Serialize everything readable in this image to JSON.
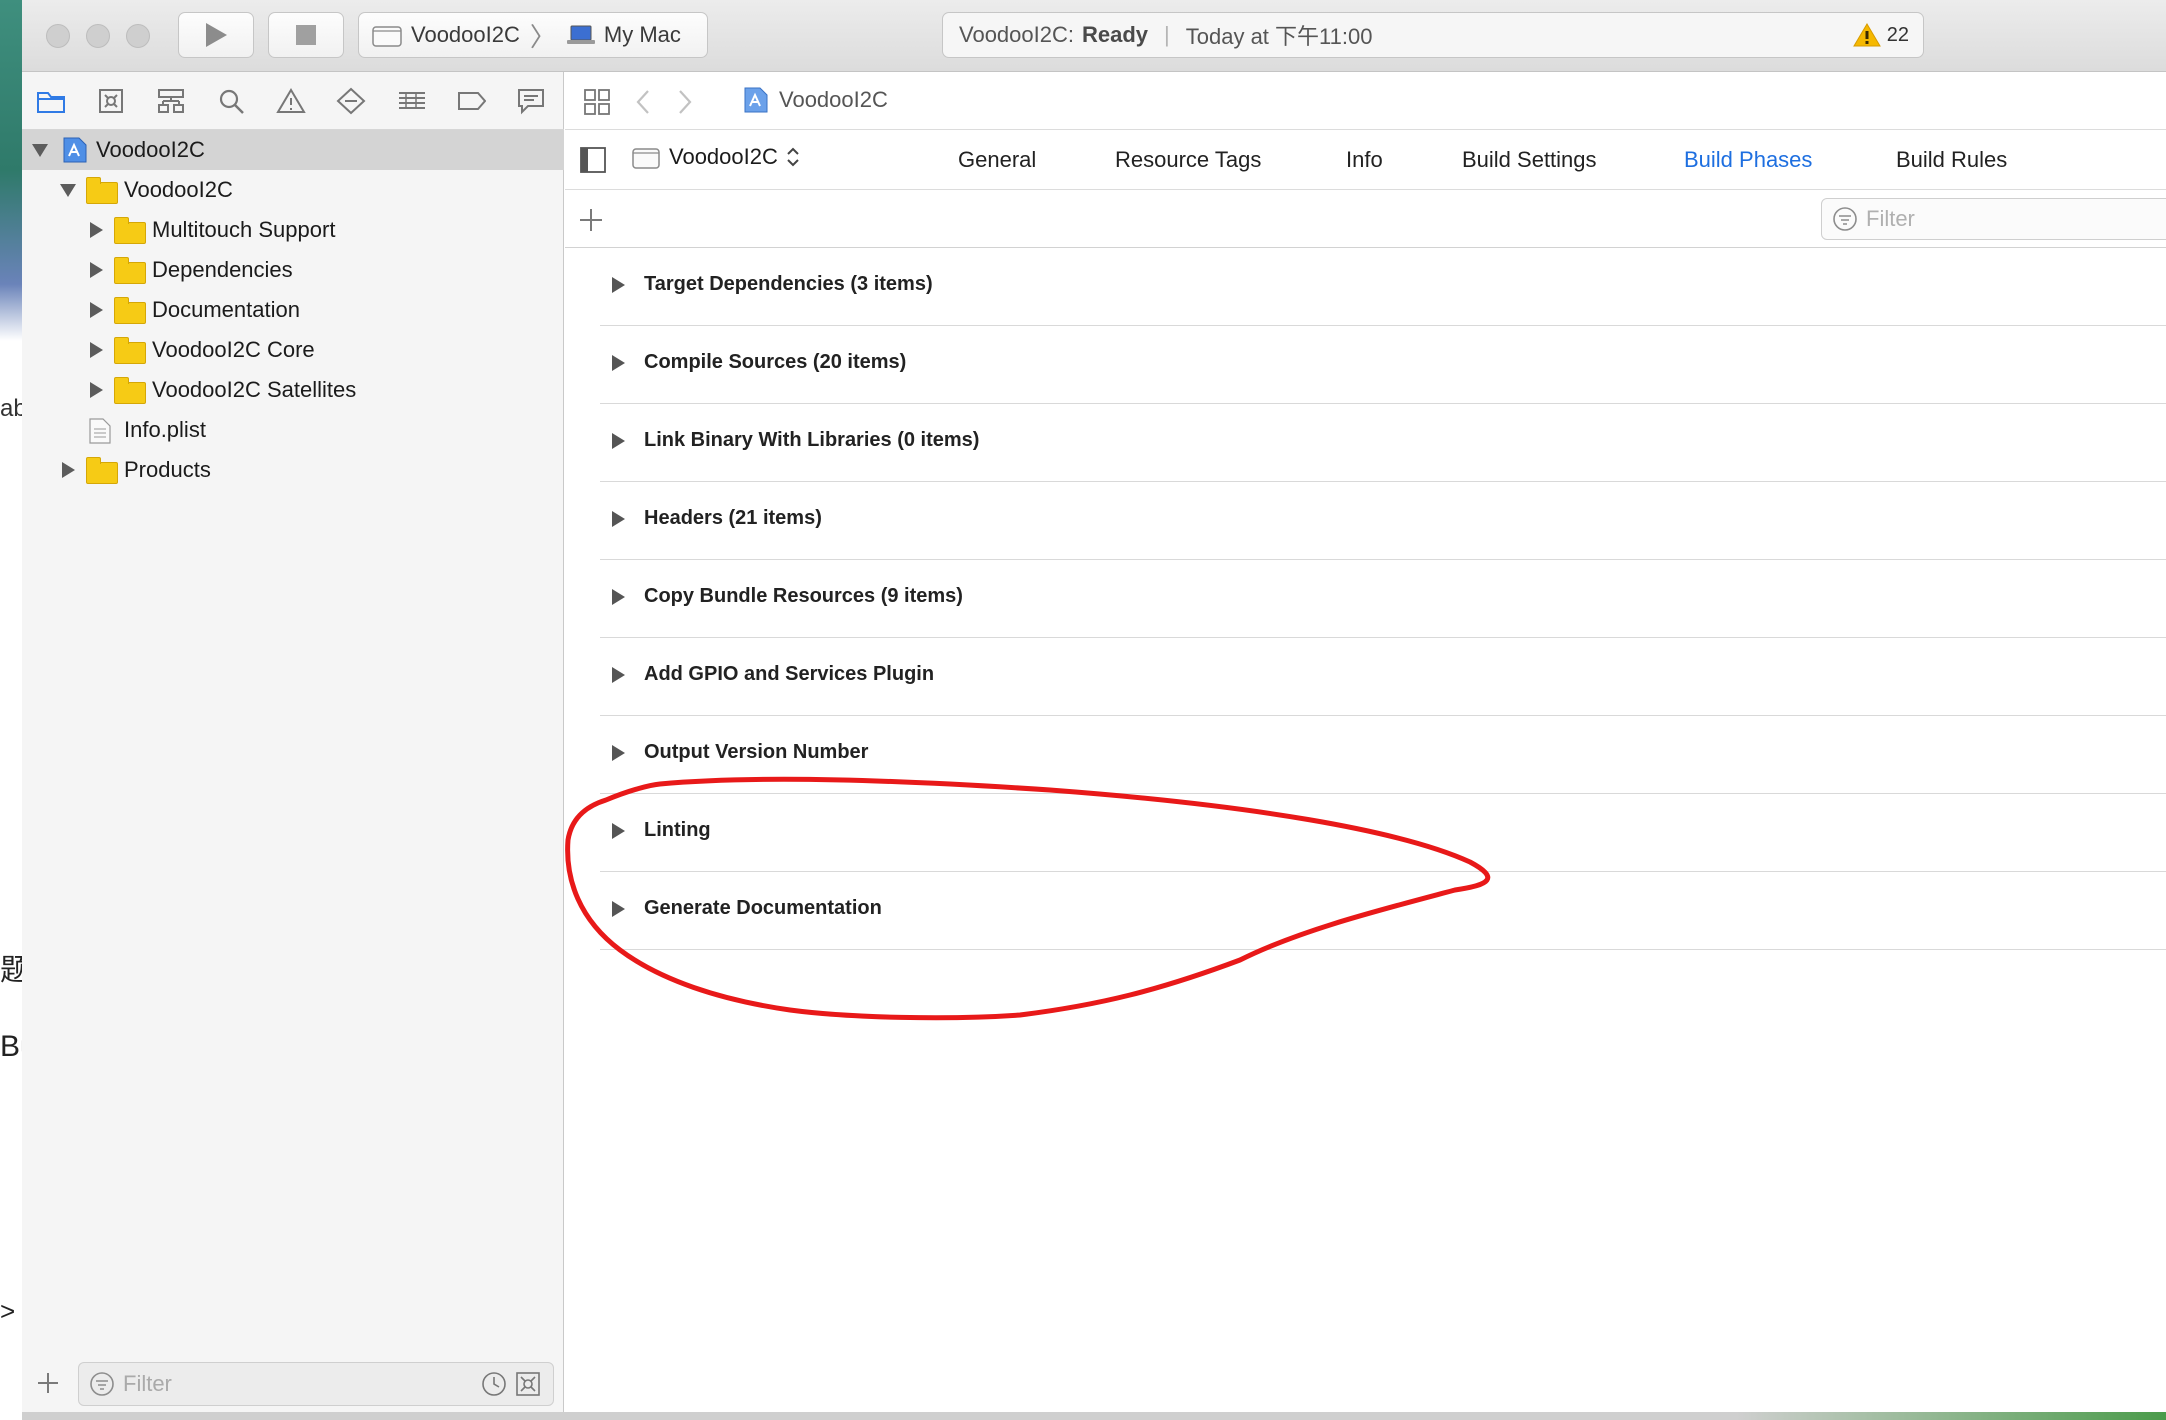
{
  "desktop": {
    "fragments": [
      "abc",
      "题",
      "Bu",
      ">"
    ]
  },
  "toolbar": {
    "scheme_target": "VoodooI2C",
    "scheme_destination": "My Mac",
    "status_project": "VoodooI2C:",
    "status_state": "Ready",
    "status_time": "Today at 下午11:00",
    "warning_count": "22"
  },
  "navigator": {
    "tree": [
      {
        "label": "VoodooI2C",
        "kind": "project",
        "depth": 0,
        "expanded": true,
        "selected": true
      },
      {
        "label": "VoodooI2C",
        "kind": "folder",
        "depth": 1,
        "expanded": true
      },
      {
        "label": "Multitouch Support",
        "kind": "folder",
        "depth": 2,
        "expanded": false
      },
      {
        "label": "Dependencies",
        "kind": "folder",
        "depth": 2,
        "expanded": false
      },
      {
        "label": "Documentation",
        "kind": "folder",
        "depth": 2,
        "expanded": false
      },
      {
        "label": "VoodooI2C Core",
        "kind": "folder",
        "depth": 2,
        "expanded": false
      },
      {
        "label": "VoodooI2C Satellites",
        "kind": "folder",
        "depth": 2,
        "expanded": false
      },
      {
        "label": "Info.plist",
        "kind": "file",
        "depth": 1
      },
      {
        "label": "Products",
        "kind": "folder",
        "depth": 0,
        "expanded": false
      }
    ],
    "filter_placeholder": "Filter"
  },
  "editor": {
    "breadcrumb": "VoodooI2C",
    "target_name": "VoodooI2C",
    "tabs": [
      "General",
      "Resource Tags",
      "Info",
      "Build Settings",
      "Build Phases",
      "Build Rules"
    ],
    "active_tab": "Build Phases",
    "filter_placeholder": "Filter",
    "phases": [
      "Target Dependencies (3 items)",
      "Compile Sources (20 items)",
      "Link Binary With Libraries (0 items)",
      "Headers (21 items)",
      "Copy Bundle Resources (9 items)",
      "Add GPIO and Services Plugin",
      "Output Version Number",
      "Linting",
      "Generate Documentation"
    ]
  },
  "colors": {
    "accent": "#1e6fe0",
    "folder": "#f6cb15",
    "annotation": "#e81919",
    "selection": "#d4d4d4"
  }
}
